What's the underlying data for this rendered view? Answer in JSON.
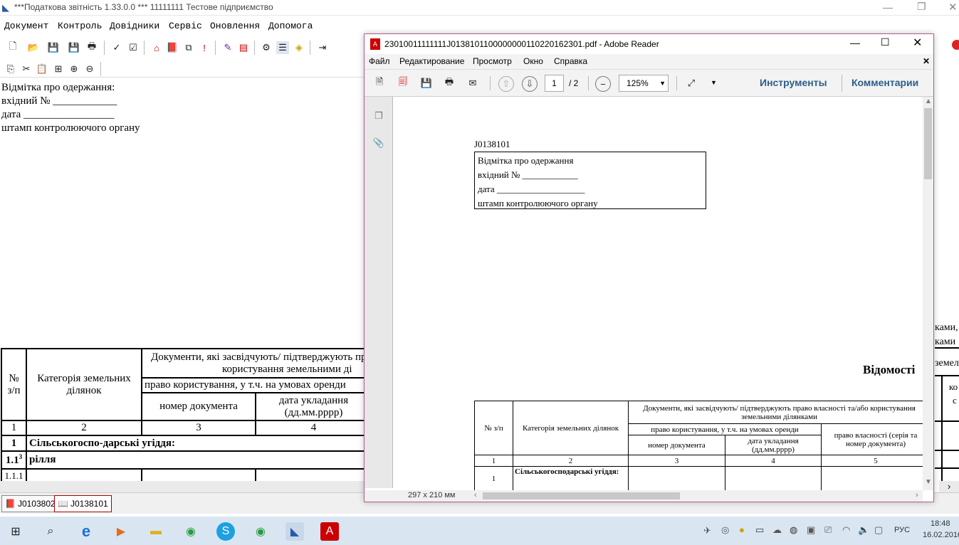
{
  "app": {
    "title": "***Податкова звітність 1.33.0.0 *** 11111111 Тестове підприємство",
    "menu": [
      "Документ",
      "Контроль",
      "Довідники",
      "Сервіс",
      "Оновлення",
      "Допомога"
    ],
    "form_lines": [
      "Відмітка про одержання:",
      "вхідний № ____________",
      "дата _________________",
      "штамп контролюючого органу"
    ],
    "table": {
      "h_num": "№ з/п",
      "h_cat": "Категорія земельних ділянок",
      "h_docs": "Документи, які засвідчують/ підтверджують право власності та/або",
      "h_docs2": "користування земельними ді",
      "h_use": "право користування, у т.ч. на умовах оренди",
      "h_docnum": "номер документа",
      "h_date": "дата укладання (дд.мм.рррр)",
      "nums": [
        "1",
        "2",
        "3",
        "4"
      ],
      "row1_num": "1",
      "row1_label": "Сільськогоспо-дарські угіддя:",
      "row2_num": "1.1",
      "row2_sup": "3",
      "row2_label": "рілля",
      "row3_num": "1.1.1"
    },
    "right_fragments": [
      "ками,",
      "ками",
      "земел",
      "ко",
      "с"
    ],
    "tabs": [
      "J0103802",
      "J0138101"
    ]
  },
  "reader": {
    "title": "23010011111111J0138101100000000110220162301.pdf - Adobe Reader",
    "menu": [
      "Файл",
      "Редактирование",
      "Просмотр",
      "Окно",
      "Справка"
    ],
    "page_current": "1",
    "page_total": "/ 2",
    "zoom": "125%",
    "tools_label": "Инструменты",
    "comments_label": "Комментарии",
    "page_size": "297 x 210 мм",
    "doc": {
      "code": "J0138101",
      "box_lines": [
        "Відмітка про одержання",
        "вхідний № ____________",
        "дата ___________________",
        "штамп контролюючого органу"
      ],
      "heading": "Відомості",
      "t_num": "№ з/п",
      "t_cat": "Категорія земельних ділянок",
      "t_docs": "Документи, які засвідчують/ підтверджують право власності та/або користування земельними ділянками",
      "t_use": "право користування, у т.ч. на умовах оренди",
      "t_own": "право власності (серія та номер документа)",
      "t_docnum": "номер документа",
      "t_date": "дата укладання (дд.мм.рррр)",
      "nums": [
        "1",
        "2",
        "3",
        "4",
        "5"
      ],
      "row1_num": "1",
      "row1_label": "Сільськогосподарські угіддя:"
    }
  },
  "taskbar": {
    "lang": "РУС",
    "time": "18:48",
    "date": "16.02.2016"
  }
}
